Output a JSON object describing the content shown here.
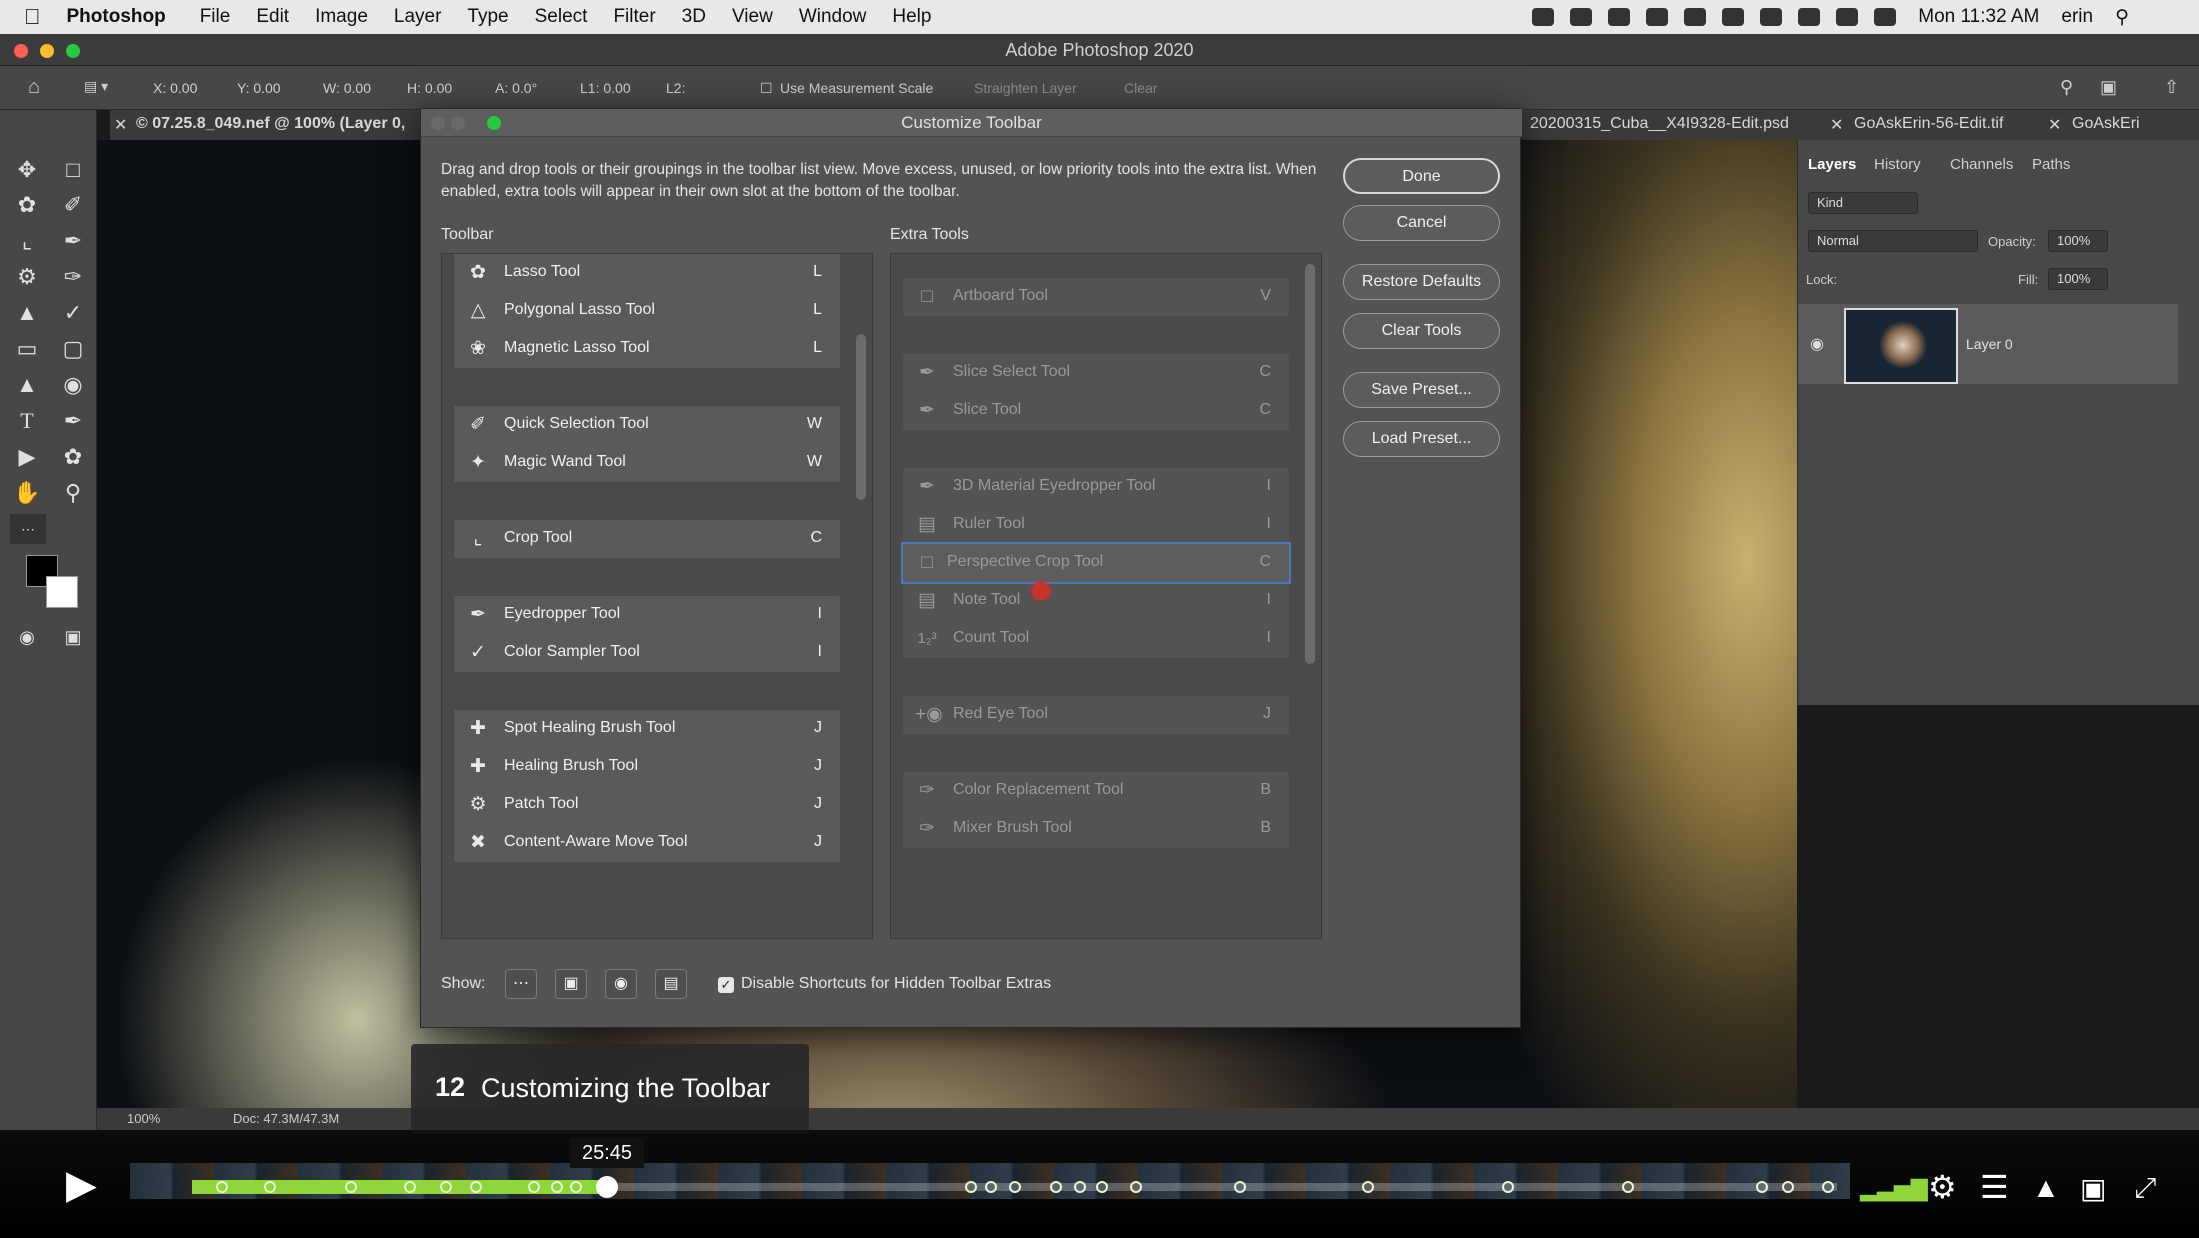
{
  "menubar": {
    "app": "Photoshop",
    "items": [
      "File",
      "Edit",
      "Image",
      "Layer",
      "Type",
      "Select",
      "Filter",
      "3D",
      "View",
      "Window",
      "Help"
    ],
    "clock": "Mon 11:32 AM",
    "user": "erin"
  },
  "window": {
    "title": "Adobe Photoshop 2020"
  },
  "options_bar": {
    "x": "X: 0.00",
    "y": "Y: 0.00",
    "w": "W: 0.00",
    "h": "H: 0.00",
    "a": "A: 0.0°",
    "l1": "L1: 0.00",
    "l2": "L2:",
    "measurement_scale": "Use Measurement Scale",
    "straighten": "Straighten Layer",
    "clear": "Clear"
  },
  "doc_tabs": {
    "active": "© 07.25.8_049.nef @ 100% (Layer 0,",
    "others": [
      "20200315_Cuba__X4I9328-Edit.psd",
      "GoAskErin-56-Edit.tif",
      "GoAskEri"
    ]
  },
  "dialog": {
    "title": "Customize Toolbar",
    "description": "Drag and drop tools or their groupings in the toolbar list view. Move excess, unused, or low priority tools into the extra list. When enabled, extra tools will appear in their own slot at the bottom of the toolbar.",
    "toolbar_label": "Toolbar",
    "extra_label": "Extra Tools",
    "toolbar_groups": [
      {
        "tools": [
          {
            "name": "Lasso Tool",
            "key": "L",
            "icon": "lasso-icon"
          },
          {
            "name": "Polygonal Lasso Tool",
            "key": "L",
            "icon": "polygonal-lasso-icon"
          },
          {
            "name": "Magnetic Lasso Tool",
            "key": "L",
            "icon": "magnetic-lasso-icon"
          }
        ]
      },
      {
        "tools": [
          {
            "name": "Quick Selection Tool",
            "key": "W",
            "icon": "quick-selection-icon"
          },
          {
            "name": "Magic Wand Tool",
            "key": "W",
            "icon": "magic-wand-icon"
          }
        ]
      },
      {
        "tools": [
          {
            "name": "Crop Tool",
            "key": "C",
            "icon": "crop-icon"
          }
        ]
      },
      {
        "tools": [
          {
            "name": "Eyedropper Tool",
            "key": "I",
            "icon": "eyedropper-icon"
          },
          {
            "name": "Color Sampler Tool",
            "key": "I",
            "icon": "color-sampler-icon"
          }
        ]
      },
      {
        "tools": [
          {
            "name": "Spot Healing Brush Tool",
            "key": "J",
            "icon": "spot-healing-icon"
          },
          {
            "name": "Healing Brush Tool",
            "key": "J",
            "icon": "healing-brush-icon"
          },
          {
            "name": "Patch Tool",
            "key": "J",
            "icon": "patch-icon"
          },
          {
            "name": "Content-Aware Move Tool",
            "key": "J",
            "icon": "content-aware-move-icon"
          }
        ]
      }
    ],
    "extra_groups": [
      {
        "tools": [
          {
            "name": "Artboard Tool",
            "key": "V",
            "icon": "artboard-icon"
          }
        ]
      },
      {
        "tools": [
          {
            "name": "Slice Select Tool",
            "key": "C",
            "icon": "slice-select-icon"
          },
          {
            "name": "Slice Tool",
            "key": "C",
            "icon": "slice-icon"
          }
        ]
      },
      {
        "tools": [
          {
            "name": "3D Material Eyedropper Tool",
            "key": "I",
            "icon": "3d-eyedropper-icon"
          },
          {
            "name": "Ruler Tool",
            "key": "I",
            "icon": "ruler-icon"
          },
          {
            "name": "Perspective Crop Tool",
            "key": "C",
            "icon": "perspective-crop-icon"
          },
          {
            "name": "Note Tool",
            "key": "I",
            "icon": "note-icon"
          },
          {
            "name": "Count Tool",
            "key": "I",
            "icon": "count-icon"
          }
        ]
      },
      {
        "tools": [
          {
            "name": "Red Eye Tool",
            "key": "J",
            "icon": "red-eye-icon"
          }
        ]
      },
      {
        "tools": [
          {
            "name": "Color Replacement Tool",
            "key": "B",
            "icon": "color-replacement-icon"
          },
          {
            "name": "Mixer Brush Tool",
            "key": "B",
            "icon": "mixer-brush-icon"
          }
        ]
      }
    ],
    "buttons": {
      "done": "Done",
      "cancel": "Cancel",
      "restore": "Restore Defaults",
      "clear": "Clear Tools",
      "save": "Save Preset...",
      "load": "Load Preset..."
    },
    "show_label": "Show:",
    "checkbox_label": "Disable Shortcuts for Hidden Toolbar Extras",
    "checkbox_checked": true
  },
  "layers_panel": {
    "tabs": [
      "Layers",
      "History",
      "Channels",
      "Paths"
    ],
    "kind": "Kind",
    "blend": "Normal",
    "opacity_label": "Opacity:",
    "opacity": "100%",
    "lock_label": "Lock:",
    "fill_label": "Fill:",
    "fill": "100%",
    "layer_name": "Layer 0"
  },
  "status_bar": {
    "zoom": "100%",
    "doc": "Doc: 47.3M/47.3M"
  },
  "caption": {
    "number": "12",
    "title": "Customizing the Toolbar"
  },
  "video": {
    "time": "25:45",
    "progress": 0.25
  },
  "colors": {
    "accent_progress": "#8ed63a",
    "dialog_bg": "#535353",
    "selection_outline": "#4d78b8"
  }
}
